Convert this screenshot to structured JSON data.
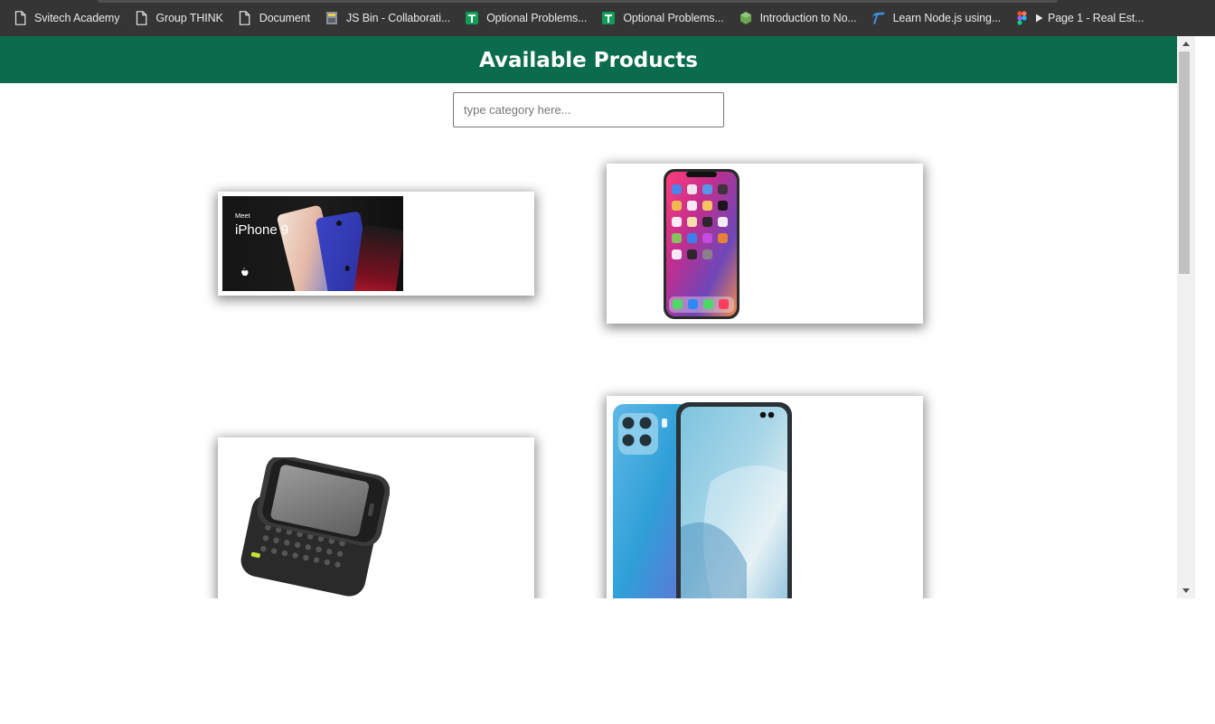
{
  "bookmarks": [
    {
      "label": "Svitech Academy",
      "icon": "page-icon"
    },
    {
      "label": "Group THINK",
      "icon": "page-icon"
    },
    {
      "label": "Document",
      "icon": "page-icon"
    },
    {
      "label": "JS Bin - Collaborati...",
      "icon": "jsbin-icon"
    },
    {
      "label": "Optional Problems...",
      "icon": "sheets-icon"
    },
    {
      "label": "Optional Problems...",
      "icon": "sheets-icon"
    },
    {
      "label": "Introduction to No...",
      "icon": "nodejs-icon"
    },
    {
      "label": "Learn Node.js using...",
      "icon": "learn-icon"
    },
    {
      "label": "Page 1 - Real Est...",
      "icon": "figma-icon"
    }
  ],
  "page": {
    "title": "Available Products",
    "search_placeholder": "type category here..."
  },
  "products": [
    {
      "image": "iphone-9-promo-image",
      "promo_small": "Meet",
      "promo_big": "iPhone 9"
    },
    {
      "image": "iphone-x-image"
    },
    {
      "image": "slider-keyboard-phone-image"
    },
    {
      "image": "blue-quad-camera-phone-image"
    }
  ],
  "colors": {
    "header_bg": "#0b6b4d",
    "bookmarks_bg": "#353535"
  }
}
